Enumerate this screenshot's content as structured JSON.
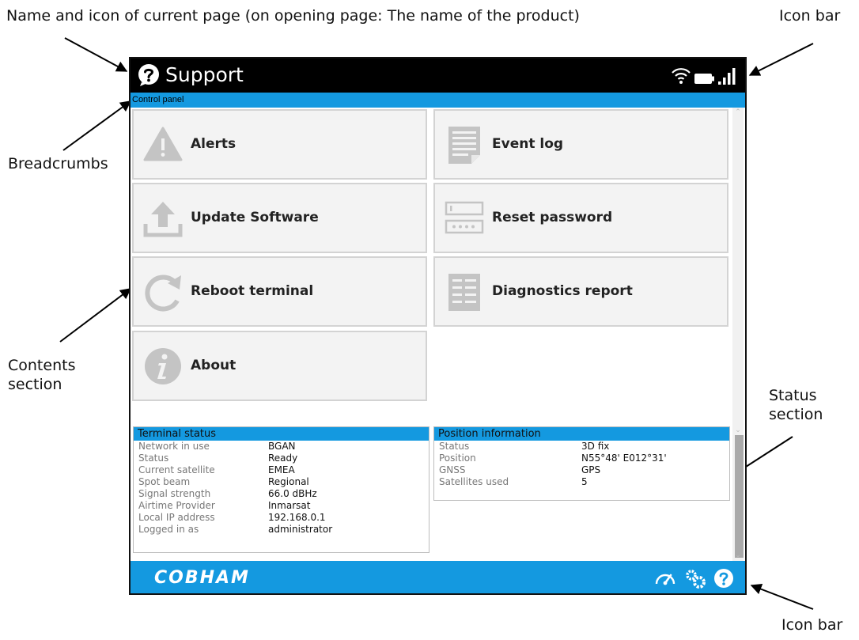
{
  "annotations": {
    "page_name": "Name and icon of current page (on opening page: The name of the product)",
    "icon_bar_top": "Icon bar",
    "breadcrumbs": "Breadcrumbs",
    "contents_line1": "Contents",
    "contents_line2": "section",
    "status_line1": "Status",
    "status_line2": "section",
    "icon_bar_bottom": "Icon bar"
  },
  "header": {
    "title": "Support",
    "title_icon": "question-circle-icon",
    "icons": [
      "wifi-icon",
      "battery-icon",
      "signal-strength-icon"
    ]
  },
  "breadcrumb": "Control panel",
  "tiles": [
    {
      "label": "Alerts",
      "icon": "warning-icon"
    },
    {
      "label": "Event log",
      "icon": "document-icon"
    },
    {
      "label": "Update Software",
      "icon": "upload-icon"
    },
    {
      "label": "Reset password",
      "icon": "password-field-icon"
    },
    {
      "label": "Reboot terminal",
      "icon": "reboot-icon"
    },
    {
      "label": "Diagnostics report",
      "icon": "report-icon"
    },
    {
      "label": "About",
      "icon": "info-icon"
    }
  ],
  "terminal_status": {
    "title": "Terminal status",
    "rows": [
      {
        "key": "Network in use",
        "value": "BGAN"
      },
      {
        "key": "Status",
        "value": "Ready"
      },
      {
        "key": "Current satellite",
        "value": "EMEA"
      },
      {
        "key": "Spot beam",
        "value": "Regional"
      },
      {
        "key": "Signal strength",
        "value": "66.0 dBHz"
      },
      {
        "key": "Airtime Provider",
        "value": "Inmarsat"
      },
      {
        "key": "Local IP address",
        "value": "192.168.0.1"
      },
      {
        "key": "Logged in as",
        "value": "administrator"
      }
    ]
  },
  "position_information": {
    "title": "Position information",
    "rows": [
      {
        "key": "Status",
        "value": "3D fix"
      },
      {
        "key": "Position",
        "value": "N55°48' E012°31'"
      },
      {
        "key": "GNSS",
        "value": "GPS"
      },
      {
        "key": "Satellites used",
        "value": "5"
      }
    ]
  },
  "footer": {
    "logo": "COBHAM",
    "icons": [
      "dashboard-icon",
      "settings-icon",
      "help-icon"
    ]
  },
  "colors": {
    "accent": "#1499e0",
    "header_bg": "#000000",
    "tile_bg": "#f3f3f3",
    "icon_grey": "#c4c4c4"
  }
}
